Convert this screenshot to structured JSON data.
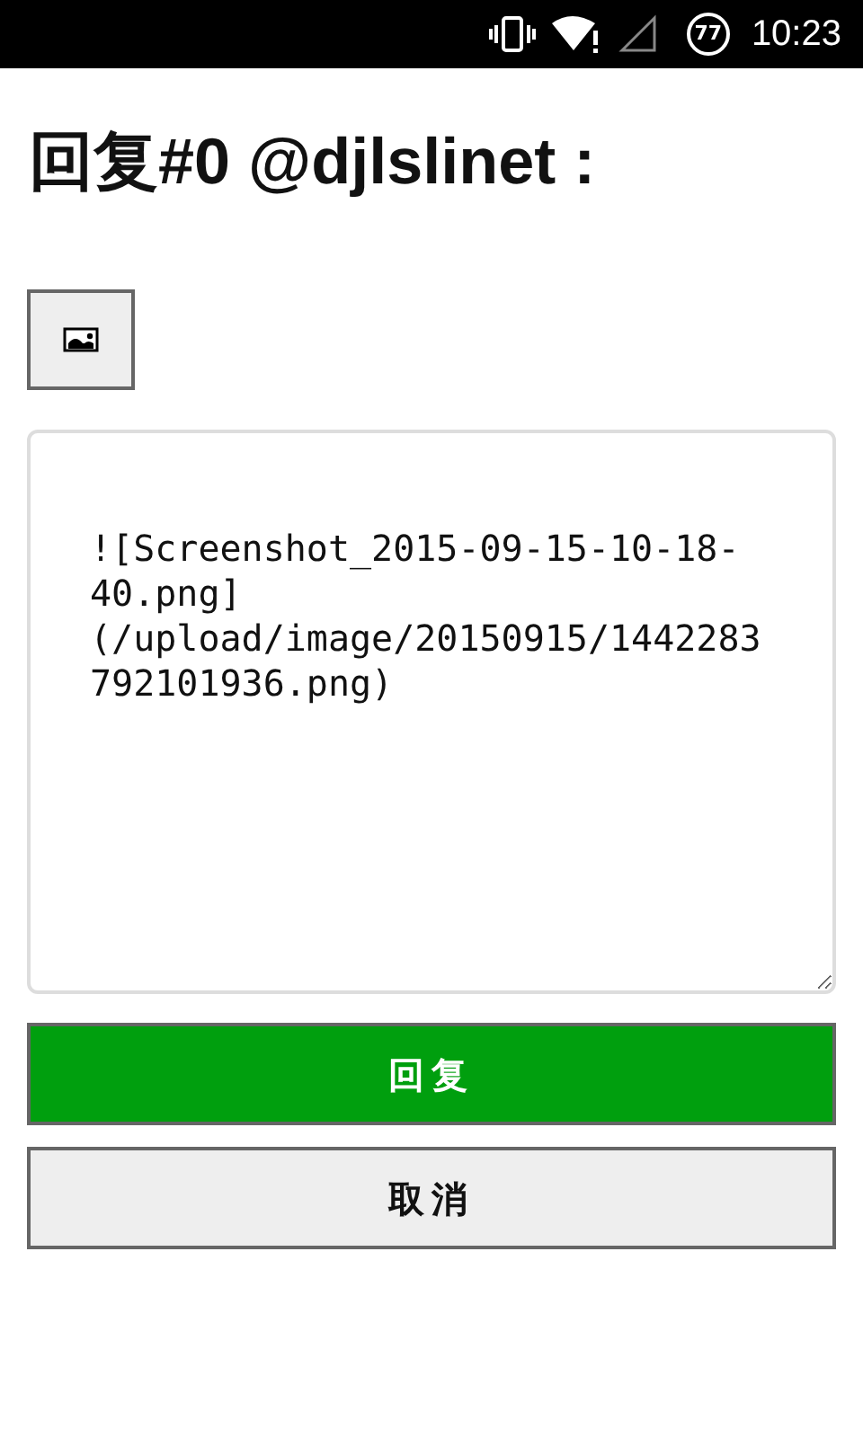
{
  "status_bar": {
    "battery": "77",
    "time": "10:23"
  },
  "title": "回复#0 @djlslinet :",
  "editor": {
    "value": "![Screenshot_2015-09-15-10-18-40.png](/upload/image/20150915/1442283792101936.png)"
  },
  "buttons": [
    {
      "label": "回复",
      "kind": "primary"
    },
    {
      "label": "取消",
      "kind": "secondary"
    }
  ]
}
